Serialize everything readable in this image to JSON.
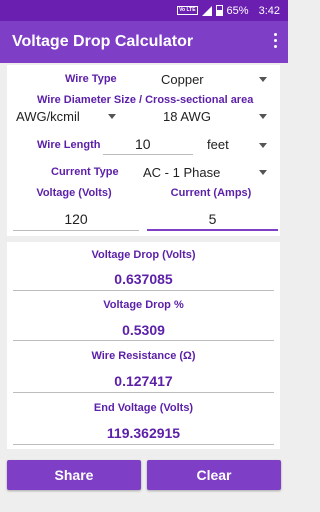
{
  "status_bar": {
    "network_badge": "Vo LTE",
    "battery": "65%",
    "time": "3:42"
  },
  "app_bar": {
    "title": "Voltage Drop Calculator",
    "menu_icon": "overflow-menu-icon"
  },
  "inputs": {
    "wire_type": {
      "label": "Wire Type",
      "value": "Copper"
    },
    "wire_size": {
      "label": "Wire Diameter Size / Cross-sectional area",
      "unit": "AWG/kcmil",
      "value": "18 AWG"
    },
    "wire_length": {
      "label": "Wire Length",
      "value": "10",
      "unit": "feet"
    },
    "current_type": {
      "label": "Current Type",
      "value": "AC - 1 Phase"
    },
    "voltage": {
      "label": "Voltage (Volts)",
      "value": "120"
    },
    "current": {
      "label": "Current (Amps)",
      "value": "5"
    }
  },
  "results": {
    "voltage_drop": {
      "label": "Voltage Drop (Volts)",
      "value": "0.637085"
    },
    "voltage_drop_pct": {
      "label": "Voltage Drop %",
      "value": "0.5309"
    },
    "wire_resistance": {
      "label": "Wire Resistance (Ω)",
      "value": "0.127417"
    },
    "end_voltage": {
      "label": "End Voltage (Volts)",
      "value": "119.362915"
    }
  },
  "buttons": {
    "share": "Share",
    "clear": "Clear"
  },
  "colors": {
    "status_bar": "#6a1fb0",
    "app_bar": "#7e3fc6",
    "accent_text": "#5b1fa8",
    "background": "#eeeeee"
  }
}
